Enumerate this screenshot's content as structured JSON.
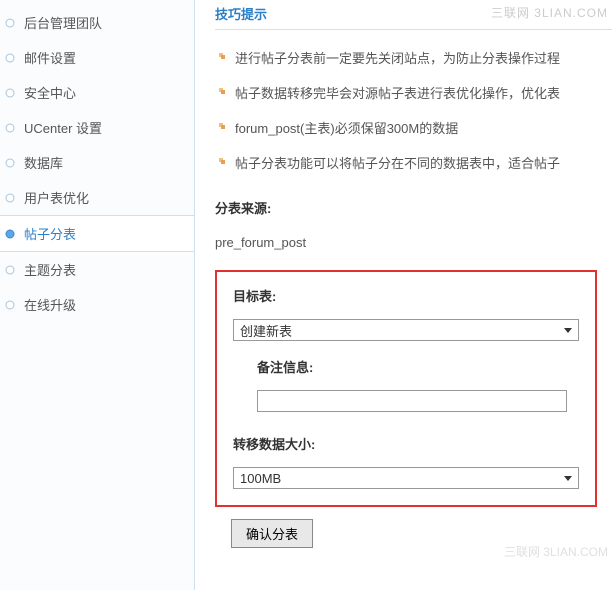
{
  "sidebar": {
    "items": [
      {
        "label": "后台管理团队"
      },
      {
        "label": "邮件设置"
      },
      {
        "label": "安全中心"
      },
      {
        "label": "UCenter 设置"
      },
      {
        "label": "数据库"
      },
      {
        "label": "用户表优化"
      },
      {
        "label": "帖子分表"
      },
      {
        "label": "主题分表"
      },
      {
        "label": "在线升级"
      }
    ]
  },
  "tips": {
    "title": "技巧提示",
    "items": [
      "进行帖子分表前一定要先关闭站点，为防止分表操作过程",
      "帖子数据转移完毕会对源帖子表进行表优化操作，优化表",
      "forum_post(主表)必须保留300M的数据",
      "帖子分表功能可以将帖子分在不同的数据表中，适合帖子"
    ]
  },
  "source": {
    "label": "分表来源:",
    "value": "pre_forum_post"
  },
  "form": {
    "target_label": "目标表:",
    "target_select": "创建新表",
    "remark_label": "备注信息:",
    "remark_value": "",
    "size_label": "转移数据大小:",
    "size_select": "100MB",
    "submit": "确认分表"
  },
  "watermark": "三联网 3LIAN.COM",
  "watermark2": "三联网 3LIAN.COM"
}
